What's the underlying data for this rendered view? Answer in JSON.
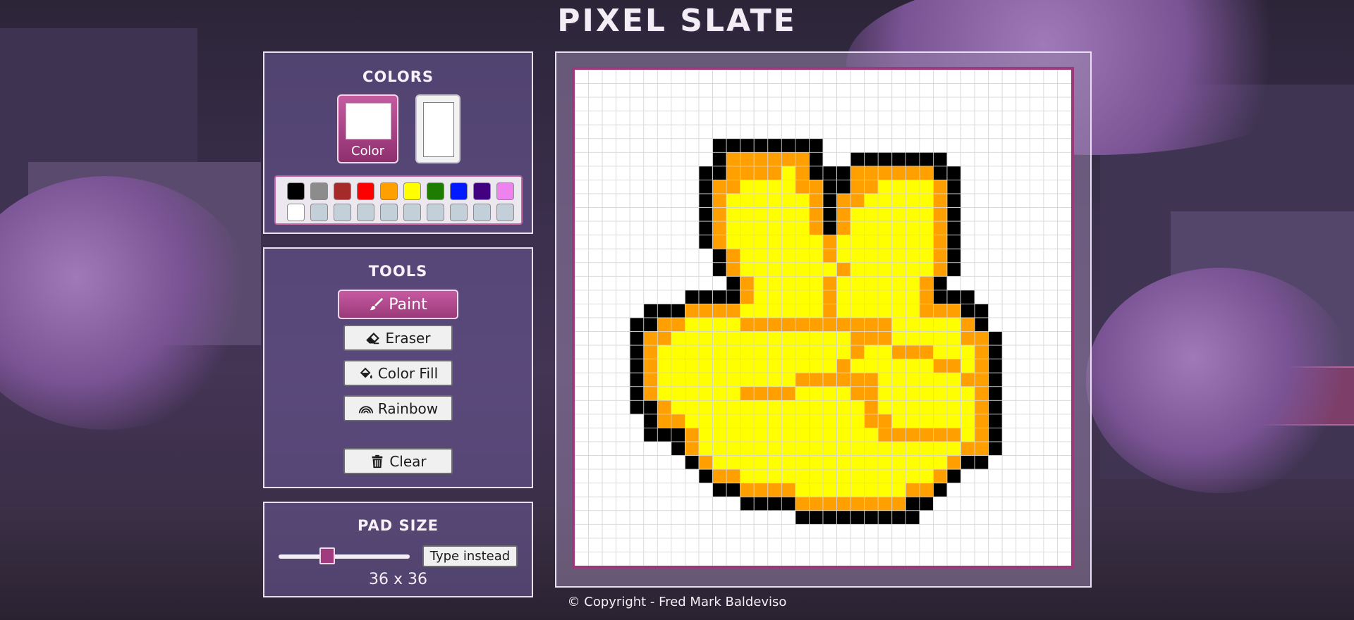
{
  "app": {
    "title": "PIXEL SLATE",
    "copyright": "© Copyright - Fred Mark Baldeviso"
  },
  "colors": {
    "heading": "COLORS",
    "primary_label": "Color",
    "primary_color": "#ffffff",
    "secondary_color": "#ffffff",
    "palette_row1": [
      "#000000",
      "#8c8c8c",
      "#a52a2a",
      "#ff0000",
      "#ff9f00",
      "#ffff00",
      "#1e7d00",
      "#0019ff",
      "#40007f",
      "#ee82ee"
    ],
    "palette_row2": [
      "#ffffff",
      "",
      "",
      "",
      "",
      "",
      "",
      "",
      "",
      ""
    ]
  },
  "tools": {
    "heading": "TOOLS",
    "paint": "Paint",
    "eraser": "Eraser",
    "fill": "Color Fill",
    "rainbow": "Rainbow",
    "clear": "Clear",
    "active": "paint"
  },
  "pad_size": {
    "heading": "PAD SIZE",
    "type_instead": "Type instead",
    "readout": "36 x 36",
    "value": 36
  },
  "canvas": {
    "grid_size": 36,
    "legend": {
      "K": "#000000",
      "O": "#ff9f00",
      "Y": "#ffff00"
    },
    "pixels": [
      "....................................",
      "....................................",
      "....................................",
      "....................................",
      "....................................",
      "..........KKKKKKKK..................",
      "..........KOOOOOOK..KKKKKKK.........",
      ".........KKOOOOYOKKKOOOOOOKK........",
      ".........KOOYYYYOOKKOOYYYYOK........",
      ".........KOYYYYYYOKOOYYYYYOK........",
      ".........KOYYYYYYOKOYYYYYYOK........",
      ".........KOYYYYYYOKOYYYYYYOK........",
      ".........KOYYYYYYYOYYYYYYYOK........",
      "..........KOYYYYYYOYYYYYYYOK........",
      "..........KOYYYYYYYOYYYYYYOK........",
      "...........KOYYYYYOYYYYYYOK.........",
      "........KKKKOYYYYYOYYYYYYOKKK.......",
      ".....KKKOOOOYYYYYYOYYYYYYOOOKK......",
      "....KKOOYYYYOOOOOOOOOOOYYYYYOK......",
      "....KOOYYYYYYYYYYYYYOOOYYYYYOOK.....",
      "....KOYYYYYYYYYYYYYYOYYOOOYYYOK.....",
      "....KOYYYYYYYYYYYYYOYYYYYYOOYOK.....",
      "....KOYYYYYYYYYYOOOOOOYYYYYYOOK.....",
      "....KOYYYYYYOOOOYYYYOOYYYYYYYOK.....",
      "....KKOYYYYYYYYYYYYYYOYYYYYYYOK.....",
      ".....KOOYYYYYYYYYYYYYOOYYYYYYOK.....",
      ".....KKKOYYYYYYYYYYYYYOOOOOOYOK.....",
      ".......KOYYYYYYYYYYYYYYYYYYYOOK.....",
      "........KOYYYYYYYYYYYYYYYYYOKK......",
      ".........KOOYYYYYYYYYYYYYYOK........",
      "..........KKOOOOYYYYYYYYOOK.........",
      "............KKKKOOOOOOOOKK..........",
      "................KKKKKKKKK...........",
      "....................................",
      "....................................",
      "...................................."
    ]
  }
}
